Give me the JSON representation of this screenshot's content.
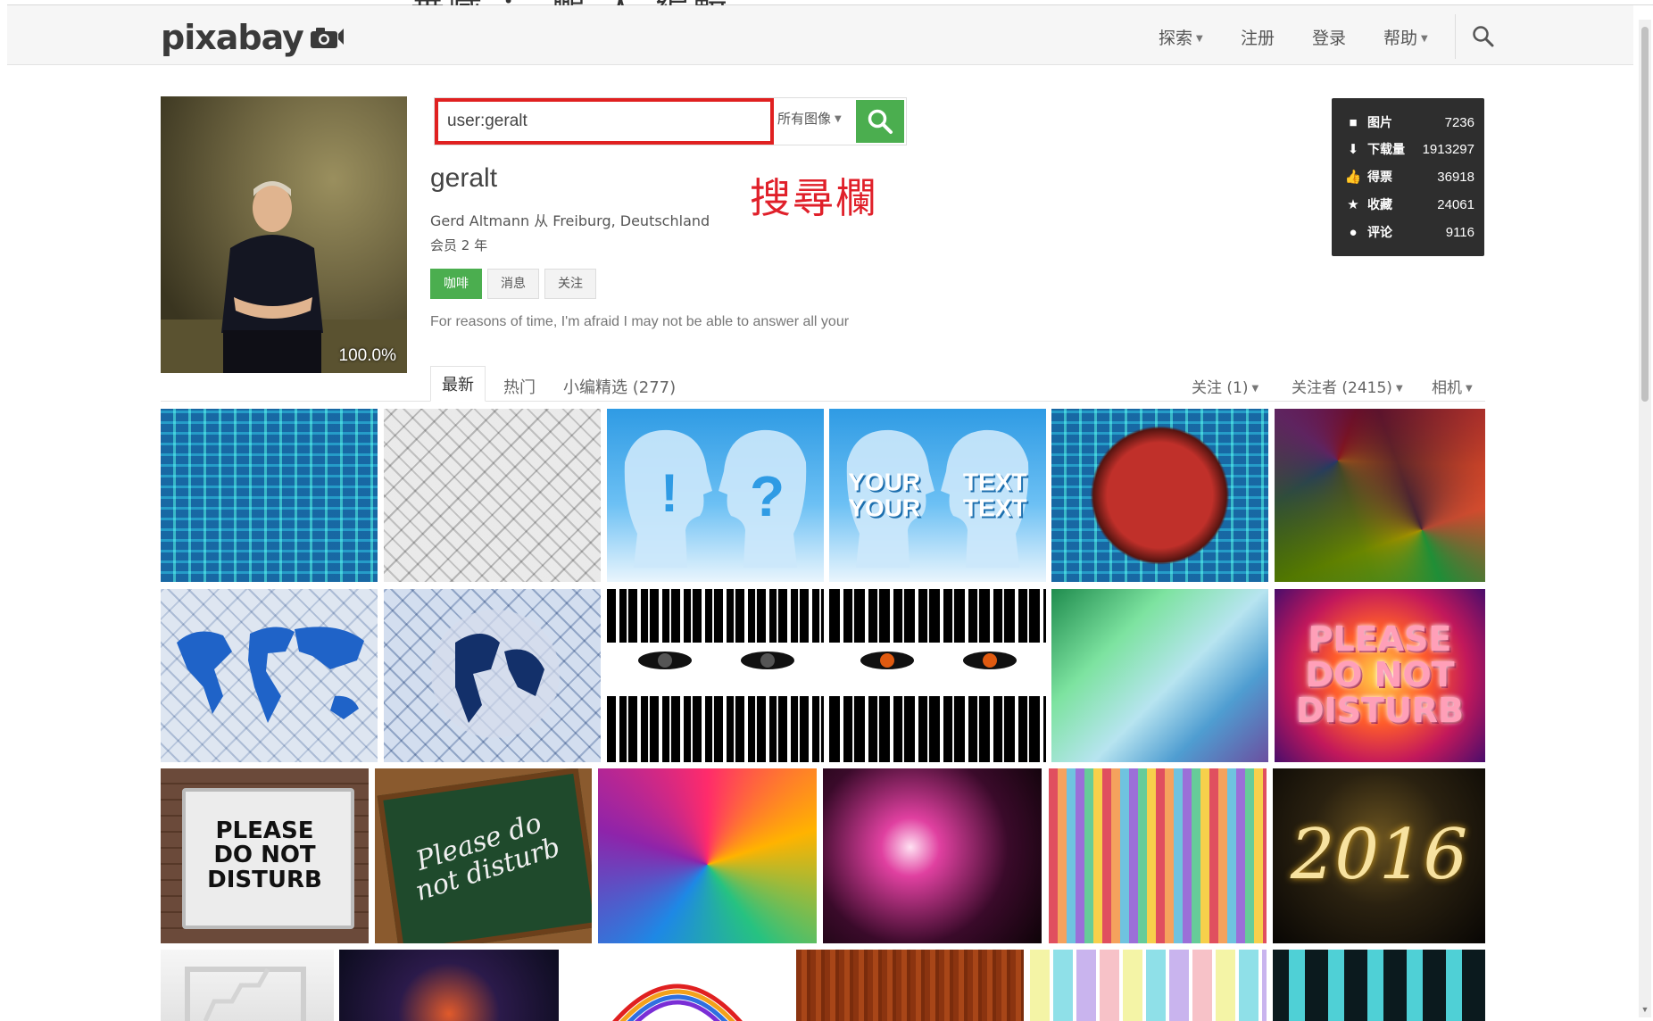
{
  "page": {
    "cropped_caption": "華藏 ： 鵬 人 編輯",
    "annotation": "搜尋欄"
  },
  "navbar": {
    "logo": "pixabay",
    "items": [
      {
        "label": "探索",
        "dropdown": true
      },
      {
        "label": "注册",
        "dropdown": false
      },
      {
        "label": "登录",
        "dropdown": false
      },
      {
        "label": "帮助",
        "dropdown": true
      }
    ],
    "search_icon": "search-icon"
  },
  "profile": {
    "avatar_zoom": "100.0%",
    "search_value": "user:geralt",
    "search_filter": "所有图像",
    "username": "geralt",
    "info": "Gerd Altmann 从 Freiburg, Deutschland",
    "membership": "会员 2 年",
    "buttons": [
      "咖啡",
      "消息",
      "关注"
    ],
    "bio": "For reasons of time, I'm afraid I may not be able to answer all your"
  },
  "stats": [
    {
      "icon": "image-icon",
      "label": "图片",
      "value": "7236"
    },
    {
      "icon": "download-icon",
      "label": "下载量",
      "value": "1913297"
    },
    {
      "icon": "thumbs-up-icon",
      "label": "得票",
      "value": "36918"
    },
    {
      "icon": "star-icon",
      "label": "收藏",
      "value": "24061"
    },
    {
      "icon": "comment-icon",
      "label": "评论",
      "value": "9116"
    }
  ],
  "tabs": {
    "left": [
      "最新",
      "热门",
      "小编精选 (277)"
    ],
    "right": [
      {
        "label": "关注 (1)",
        "dropdown": true
      },
      {
        "label": "关注者 (2415)",
        "dropdown": true
      },
      {
        "label": "相机",
        "dropdown": true
      }
    ]
  },
  "gallery": [
    {
      "name": "circuit-board-blue",
      "text": ""
    },
    {
      "name": "white-circuit-pattern",
      "text": ""
    },
    {
      "name": "heads-exclaim-question",
      "text": ""
    },
    {
      "name": "heads-your-text",
      "text": "YOUR TEXT    YOUR TEXT"
    },
    {
      "name": "circuit-sphere",
      "text": ""
    },
    {
      "name": "colorful-mosaic",
      "text": ""
    },
    {
      "name": "world-map-blue",
      "text": ""
    },
    {
      "name": "globe-circuit",
      "text": ""
    },
    {
      "name": "eye-black-white",
      "text": ""
    },
    {
      "name": "eye-orange",
      "text": ""
    },
    {
      "name": "green-light-waves",
      "text": ""
    },
    {
      "name": "please-do-not-disturb-neon",
      "text": "PLEASE DO NOT DISTURB"
    },
    {
      "name": "please-do-not-disturb-sign",
      "text": "PLEASE DO NOT DISTURB"
    },
    {
      "name": "please-do-not-disturb-chalkboard",
      "text": "Please do not disturb"
    },
    {
      "name": "feather-fireworks",
      "text": ""
    },
    {
      "name": "pink-fireworks",
      "text": ""
    },
    {
      "name": "rainbow-stripes",
      "text": ""
    },
    {
      "name": "gold-2016-fireworks",
      "text": "2016"
    },
    {
      "name": "white-stairs",
      "text": ""
    },
    {
      "name": "fireworks-rainbow",
      "text": ""
    },
    {
      "name": "rainbow-arch",
      "text": ""
    },
    {
      "name": "wood-texture",
      "text": ""
    },
    {
      "name": "pastel-stripes",
      "text": ""
    },
    {
      "name": "teal-windows",
      "text": ""
    }
  ],
  "colors": {
    "accent": "#4bae4f",
    "annotation": "#e0202a",
    "stats_bg": "#2e2e2e"
  }
}
